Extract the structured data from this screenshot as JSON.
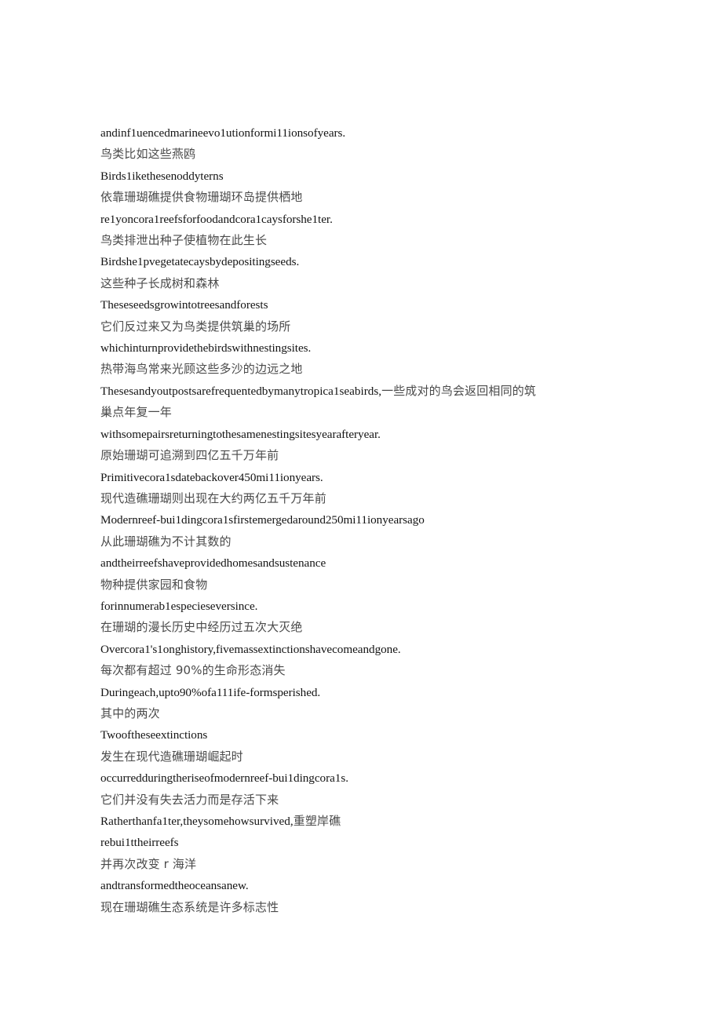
{
  "document": {
    "page_background": "#ffffff",
    "text_color_latin": "#141414",
    "text_color_cjk": "#4a4a4a",
    "lines": [
      {
        "id": "l01",
        "script": "en",
        "text": "andinf1uencedmarineevo1utionformi11ionsofyears."
      },
      {
        "id": "l02",
        "script": "zh",
        "text": "鸟类比如这些燕鸥"
      },
      {
        "id": "l03",
        "script": "en",
        "text": "Birds1ikethesenoddyterns"
      },
      {
        "id": "l04",
        "script": "zh",
        "text": "依靠珊瑚礁提供食物珊瑚环岛提供栖地"
      },
      {
        "id": "l05",
        "script": "en",
        "text": "re1yoncora1reefsforfoodandcora1caysforshe1ter."
      },
      {
        "id": "l06",
        "script": "zh",
        "text": "鸟类排泄出种子使植物在此生长"
      },
      {
        "id": "l07",
        "script": "en",
        "text": "Birdshe1pvegetatecaysbydepositingseeds."
      },
      {
        "id": "l08",
        "script": "zh",
        "text": "这些种子长成树和森林"
      },
      {
        "id": "l09",
        "script": "en",
        "text": "Theseseedsgrowintotreesandforests"
      },
      {
        "id": "l10",
        "script": "zh",
        "text": "它们反过来又为鸟类提供筑巢的场所"
      },
      {
        "id": "l11",
        "script": "en",
        "text": "whichinturnprovidethebirdswithnestingsites."
      },
      {
        "id": "l12",
        "script": "zh",
        "text": "热带海鸟常来光顾这些多沙的边远之地"
      },
      {
        "id": "l13",
        "script": "mixed",
        "latin": "Thesesandyoutpostsarefrequentedbymanytropica1seabirds,",
        "cjk": "一些成对的鸟会返回相同的筑巢点年复一年"
      },
      {
        "id": "l14",
        "script": "en",
        "text": "withsomepairsreturningtothesamenestingsitesyearafteryear."
      },
      {
        "id": "l15",
        "script": "zh",
        "text": "原始珊瑚可追溯到四亿五千万年前"
      },
      {
        "id": "l16",
        "script": "en",
        "text": "Primitivecora1sdatebackover450mi11ionyears."
      },
      {
        "id": "l17",
        "script": "zh",
        "text": "现代造礁珊瑚则出现在大约两亿五千万年前"
      },
      {
        "id": "l18",
        "script": "en",
        "text": "Modernreef-bui1dingcora1sfirstemergedaround250mi11ionyearsago"
      },
      {
        "id": "l19",
        "script": "zh",
        "text": "从此珊瑚礁为不计其数的"
      },
      {
        "id": "l20",
        "script": "en",
        "text": "andtheirreefshaveprovidedhomesandsustenance"
      },
      {
        "id": "l21",
        "script": "zh",
        "text": "物种提供家园和食物"
      },
      {
        "id": "l22",
        "script": "en",
        "text": "forinnumerab1especieseversince."
      },
      {
        "id": "l23",
        "script": "zh",
        "text": "在珊瑚的漫长历史中经历过五次大灭绝"
      },
      {
        "id": "l24",
        "script": "en",
        "text": "Overcora1's1onghistory,fivemassextinctionshavecomeandgone."
      },
      {
        "id": "l25",
        "script": "zh",
        "text": "每次都有超过 90%的生命形态消失"
      },
      {
        "id": "l26",
        "script": "en",
        "text": "Duringeach,upto90%ofa111ife-formsperished."
      },
      {
        "id": "l27",
        "script": "zh",
        "text": "其中的两次"
      },
      {
        "id": "l28",
        "script": "en",
        "text": "Twooftheseextinctions"
      },
      {
        "id": "l29",
        "script": "zh",
        "text": "发生在现代造礁珊瑚崛起时"
      },
      {
        "id": "l30",
        "script": "en",
        "text": "occurredduringtheriseofmodernreef-bui1dingcora1s."
      },
      {
        "id": "l31",
        "script": "zh",
        "text": "它们并没有失去活力而是存活下来"
      },
      {
        "id": "l32",
        "script": "mixed",
        "latin": "Ratherthanfa1ter,theysomehowsurvived,",
        "cjk": "重塑岸礁"
      },
      {
        "id": "l33",
        "script": "en",
        "text": "rebui1ttheirreefs"
      },
      {
        "id": "l34",
        "script": "zh",
        "text": "并再次改变 r 海洋"
      },
      {
        "id": "l35",
        "script": "en",
        "text": "andtransformedtheoceansanew."
      },
      {
        "id": "l36",
        "script": "zh",
        "text": "现在珊瑚礁生态系统是许多标志性"
      }
    ]
  }
}
